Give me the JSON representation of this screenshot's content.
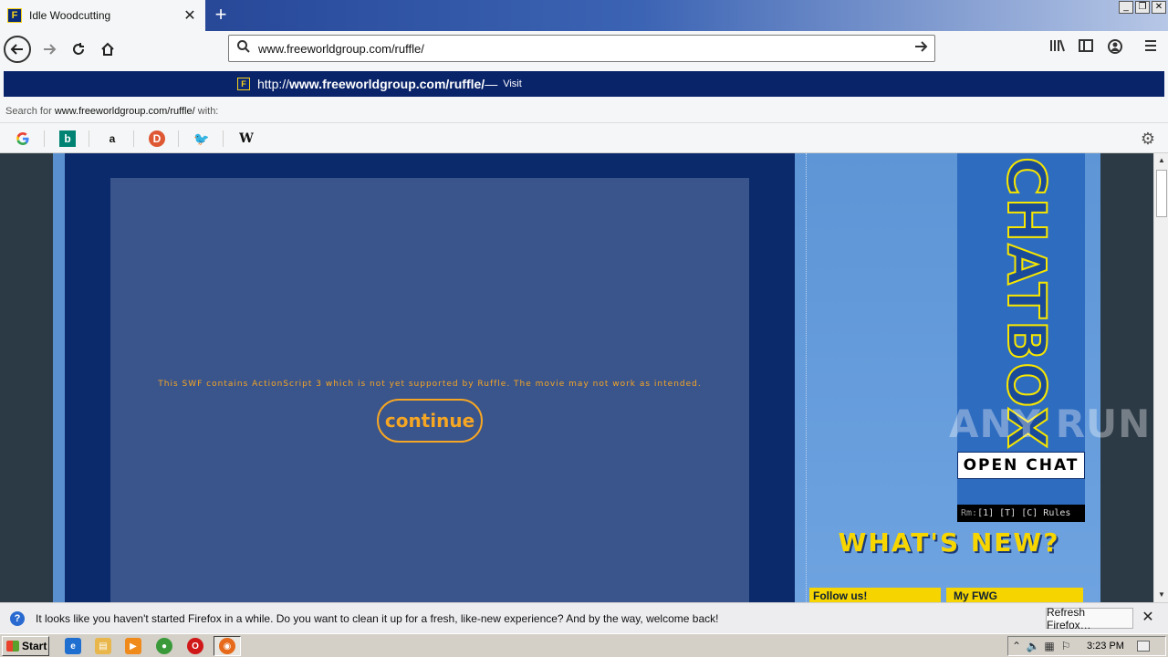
{
  "browser": {
    "tab_title": "Idle Woodcutting",
    "tab_close": "✕",
    "new_tab": "+",
    "url": "www.freeworldgroup.com/ruffle/",
    "window_controls": [
      "_",
      "❐",
      "✕"
    ]
  },
  "dropdown": {
    "suggestion_prefix": "http://",
    "suggestion_url": "www.freeworldgroup.com/ruffle/",
    "suggestion_dash": " — ",
    "suggestion_action": "Visit",
    "search_for_prefix": "Search for ",
    "search_for_term": "www.freeworldgroup.com/ruffle/",
    "search_for_suffix": " with:",
    "engines": [
      "Google",
      "Bing",
      "Amazon",
      "DuckDuckGo",
      "Twitter",
      "Wikipedia"
    ]
  },
  "page": {
    "flash_message": "This SWF contains ActionScript 3 which is not yet supported by Ruffle. The movie may not work as intended.",
    "continue_label": "continue",
    "chatbox_label": "CHATBOX",
    "open_chat_label": "OPEN CHAT",
    "rm_label": "Rm:",
    "rm_links": "[1] [T] [C] Rules",
    "whats_new": "WHAT'S NEW?",
    "follow_us": "Follow us!",
    "my_fwg": "My FWG",
    "watermark": "ANY RUN"
  },
  "notification": {
    "message": "It looks like you haven't started Firefox in a while. Do you want to clean it up for a fresh, like-new experience? And by the way, welcome back!",
    "refresh_label": "Refresh Firefox…",
    "close": "✕"
  },
  "taskbar": {
    "start_label": "Start",
    "clock": "3:23 PM"
  }
}
